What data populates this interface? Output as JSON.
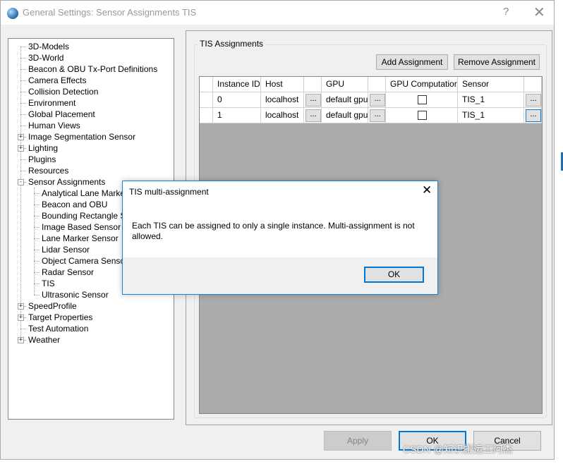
{
  "window": {
    "title": "General Settings: Sensor Assignments TIS",
    "help_label": "?",
    "close_label": "✕"
  },
  "tree": {
    "items": [
      {
        "label": "3D-Models",
        "expander": ""
      },
      {
        "label": "3D-World",
        "expander": ""
      },
      {
        "label": "Beacon & OBU Tx-Port Definitions",
        "expander": ""
      },
      {
        "label": "Camera Effects",
        "expander": ""
      },
      {
        "label": "Collision Detection",
        "expander": ""
      },
      {
        "label": "Environment",
        "expander": ""
      },
      {
        "label": "Global Placement",
        "expander": ""
      },
      {
        "label": "Human Views",
        "expander": ""
      },
      {
        "label": "Image Segmentation Sensor",
        "expander": "+"
      },
      {
        "label": "Lighting",
        "expander": "+"
      },
      {
        "label": "Plugins",
        "expander": ""
      },
      {
        "label": "Resources",
        "expander": ""
      },
      {
        "label": "Sensor Assignments",
        "expander": "-"
      },
      {
        "label": "Analytical Lane Marker S",
        "expander": ""
      },
      {
        "label": "Beacon and OBU",
        "expander": ""
      },
      {
        "label": "Bounding Rectangle Sen",
        "expander": ""
      },
      {
        "label": "Image Based Sensor",
        "expander": ""
      },
      {
        "label": "Lane Marker Sensor",
        "expander": ""
      },
      {
        "label": "Lidar Sensor",
        "expander": ""
      },
      {
        "label": "Object Camera Sensor",
        "expander": ""
      },
      {
        "label": "Radar Sensor",
        "expander": ""
      },
      {
        "label": "TIS",
        "expander": ""
      },
      {
        "label": "Ultrasonic Sensor",
        "expander": ""
      },
      {
        "label": "SpeedProfile",
        "expander": "+"
      },
      {
        "label": "Target Properties",
        "expander": "+"
      },
      {
        "label": "Test Automation",
        "expander": ""
      },
      {
        "label": "Weather",
        "expander": "+"
      }
    ]
  },
  "assignments": {
    "group_title": "TIS Assignments",
    "add_label": "Add Assignment",
    "remove_label": "Remove Assignment",
    "columns": [
      "Instance ID",
      "Host",
      "",
      "GPU",
      "",
      "GPU Computation",
      "Sensor",
      ""
    ],
    "rows": [
      {
        "instance_id": "0",
        "host": "localhost",
        "gpu": "default gpu",
        "gpu_computation": false,
        "sensor": "TIS_1"
      },
      {
        "instance_id": "1",
        "host": "localhost",
        "gpu": "default gpu",
        "gpu_computation": false,
        "sensor": "TIS_1"
      }
    ],
    "ellipsis": "..."
  },
  "footer": {
    "apply_label": "Apply",
    "ok_label": "OK",
    "cancel_label": "Cancel"
  },
  "dialog": {
    "title": "TIS multi-assignment",
    "close_label": "✕",
    "message": "Each TIS can be assigned to only a single instance. Multi-assignment is not allowed.",
    "ok_label": "OK"
  },
  "watermark": "CSDN @知识搬运工阿杰",
  "colors": {
    "accent": "#0078d7",
    "dialog_border": "#1883d7",
    "grid_background": "#ababab",
    "window_background": "#f0f0f0"
  }
}
